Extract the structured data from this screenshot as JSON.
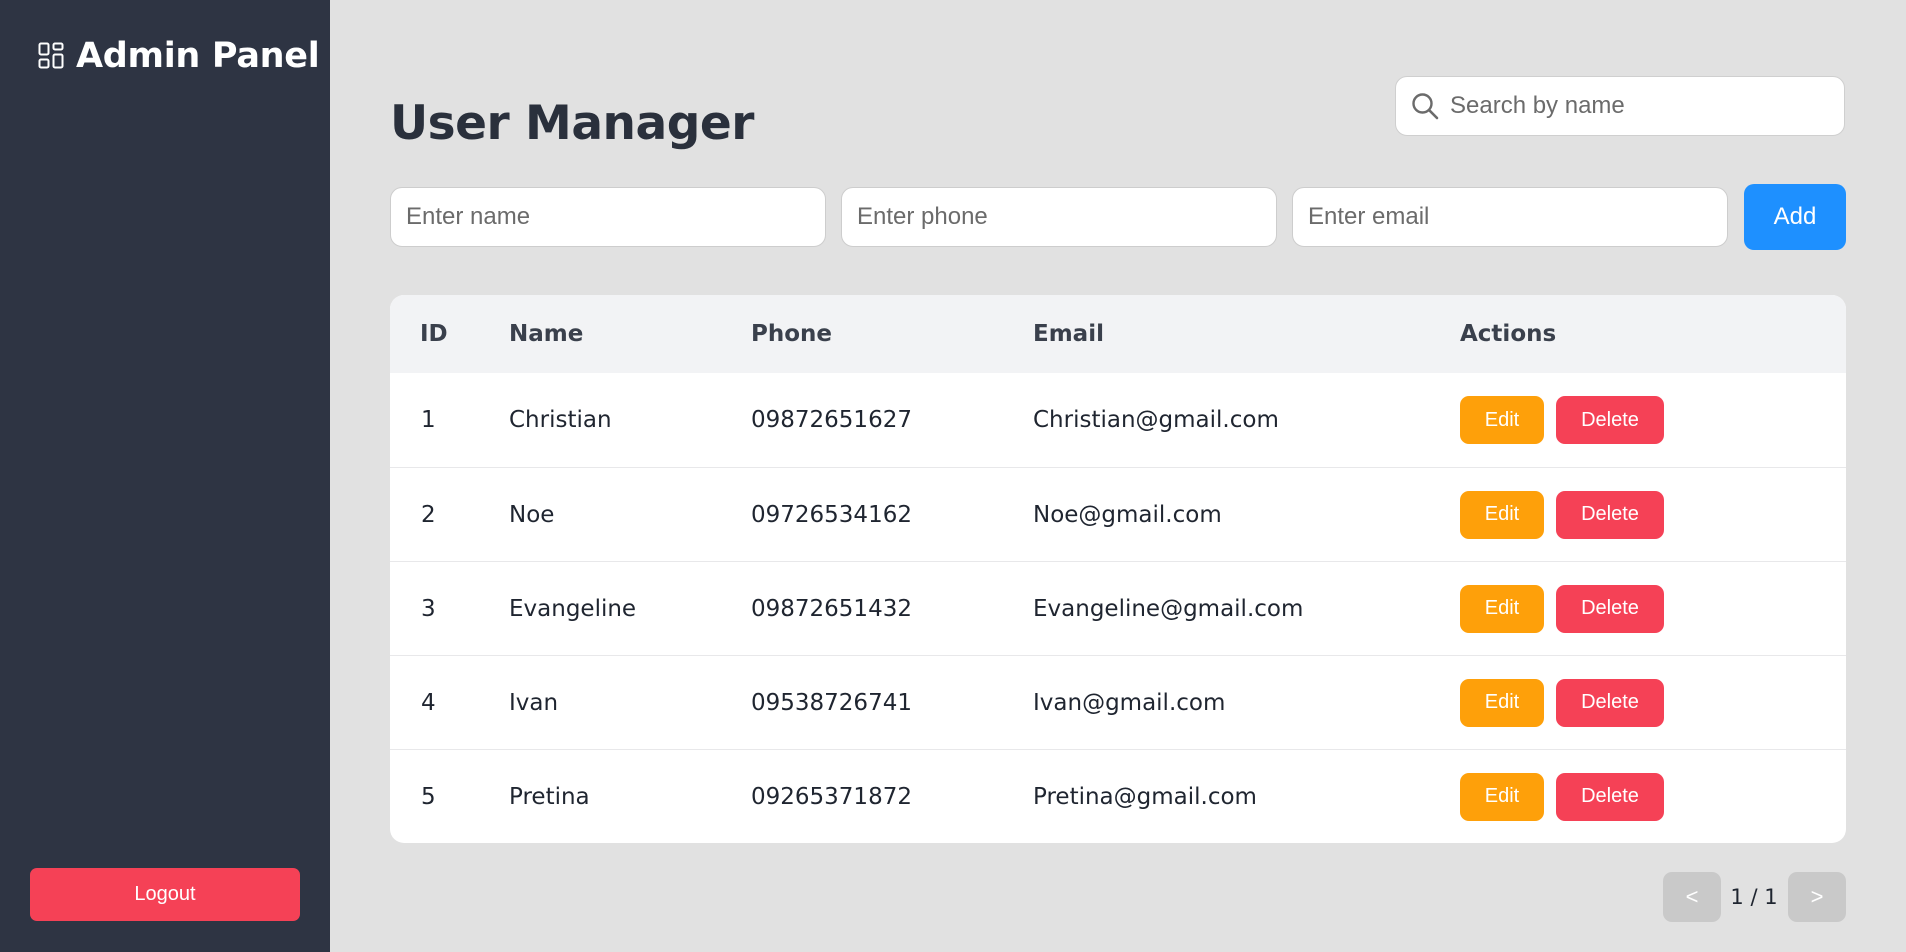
{
  "sidebar": {
    "brand_icon": "dashboard-grid-icon",
    "brand_title": "Admin Panel",
    "logout_label": "Logout"
  },
  "header": {
    "title": "User Manager",
    "search_icon": "search-icon",
    "search_placeholder": "Search by name"
  },
  "form": {
    "name_placeholder": "Enter name",
    "phone_placeholder": "Enter phone",
    "email_placeholder": "Enter email",
    "add_label": "Add"
  },
  "table": {
    "headers": [
      "ID",
      "Name",
      "Phone",
      "Email",
      "Actions"
    ],
    "rows": [
      {
        "id": "1",
        "name": "Christian",
        "phone": "09872651627",
        "email": "Christian@gmail.com"
      },
      {
        "id": "2",
        "name": "Noe",
        "phone": "09726534162",
        "email": "Noe@gmail.com"
      },
      {
        "id": "3",
        "name": "Evangeline",
        "phone": "09872651432",
        "email": "Evangeline@gmail.com"
      },
      {
        "id": "4",
        "name": "Ivan",
        "phone": "09538726741",
        "email": "Ivan@gmail.com"
      },
      {
        "id": "5",
        "name": "Pretina",
        "phone": "09265371872",
        "email": "Pretina@gmail.com"
      }
    ],
    "edit_label": "Edit",
    "delete_label": "Delete"
  },
  "pagination": {
    "prev_label": "<",
    "next_label": ">",
    "page_indicator": "1 / 1"
  },
  "colors": {
    "sidebar_bg": "#2e3443",
    "accent_blue": "#1e90ff",
    "edit_orange": "#fea00a",
    "delete_red": "#f54156",
    "page_bg": "#e1e1e1"
  }
}
